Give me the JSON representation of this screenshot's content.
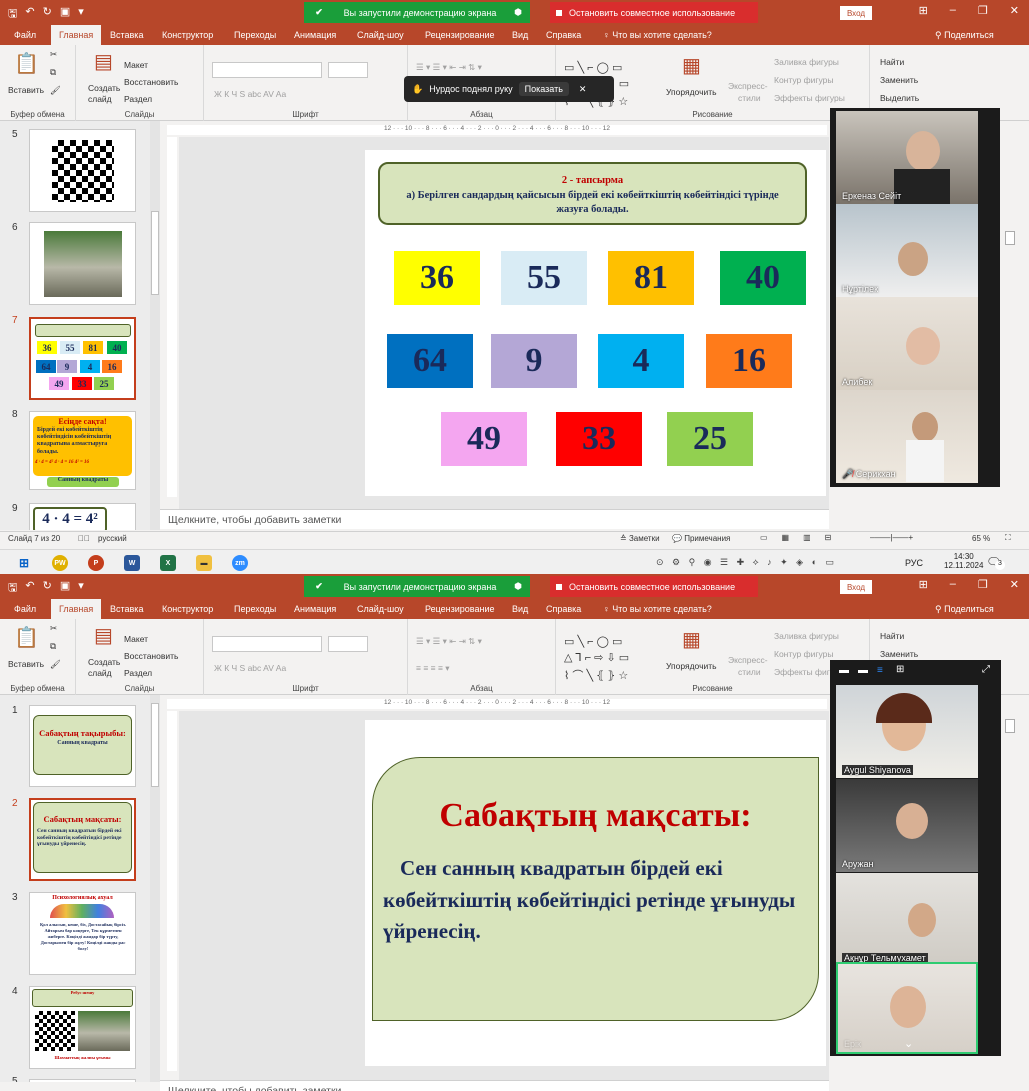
{
  "window": {
    "share_text": "Вы запустили демонстрацию экрана",
    "stop_share": "Остановить совместное использование",
    "sign_in": "Вход"
  },
  "menu": [
    "Файл",
    "Главная",
    "Вставка",
    "Конструктор",
    "Переходы",
    "Анимация",
    "Слайд-шоу",
    "Рецензирование",
    "Вид",
    "Справка"
  ],
  "menu_search": "Что вы хотите сделать?",
  "menu_share": "Поделиться",
  "ribbon": {
    "paste": "Вставить",
    "create": "Создать",
    "slide": "слайд",
    "layout": "Макет",
    "reset": "Восстановить",
    "section": "Раздел",
    "clipboard": "Буфер обмена",
    "slides": "Слайды",
    "font": "Шрифт",
    "paragraph": "Абзац",
    "drawing": "Рисование",
    "arrange": "Упорядочить",
    "express": "Экспресс-",
    "styles": "стили",
    "fill": "Заливка фигуры",
    "outline": "Контур фигуры",
    "effects": "Эффекты фигуры",
    "find": "Найти",
    "replace": "Заменить",
    "select": "Выделить",
    "fmt_buttons": "Ж  К  Ч  S  abc  AV  Aa"
  },
  "notify": {
    "text": "Нурдос поднял руку",
    "show": "Показать"
  },
  "ruler_text": "12 · · · 10 · · · 8 · · · 6 · · · 4 · · · 2 · · · 0 · · · 2 · · · 4 · · · 6 · · · 8 · · · 10 · · · 12",
  "top": {
    "thumb_nums": [
      "5",
      "6",
      "7",
      "8",
      "9"
    ],
    "slide8": {
      "title": "Есіңде сақта!",
      "body": "Бірдей екі көбейткіштің көбейтіндісін көбейткіштің квадратына алмастыруға болады.",
      "formula": "4 · 4 = 4²   4 · 4 = 16   4² = 16",
      "footer": "Санның квадраты"
    },
    "slide9_formula": "4 · 4 = 4²",
    "slide": {
      "task_title": "2 - тапсырма",
      "task_body": "а) Берілген сандардың қайсысын бірдей екі көбейткіштің көбейтіндісі түрінде жазуға болады.",
      "numbers": [
        {
          "v": "36",
          "c": "#ffff00"
        },
        {
          "v": "55",
          "c": "#d9ecf5"
        },
        {
          "v": "81",
          "c": "#ffc000"
        },
        {
          "v": "40",
          "c": "#00b050"
        },
        {
          "v": "64",
          "c": "#0070c0"
        },
        {
          "v": "9",
          "c": "#b4a7d6"
        },
        {
          "v": "4",
          "c": "#00b0f0"
        },
        {
          "v": "16",
          "c": "#ff7b1a"
        },
        {
          "v": "49",
          "c": "#f4a6f0"
        },
        {
          "v": "33",
          "c": "#ff0000"
        },
        {
          "v": "25",
          "c": "#92d050"
        }
      ]
    },
    "notes": "Щелкните, чтобы добавить заметки",
    "status": {
      "slide": "Слайд 7 из 20",
      "lang": "русский",
      "notes": "Заметки",
      "comments": "Примечания",
      "zoom": "65 %"
    },
    "participants": [
      "Еркеназ Сейіт",
      "Нұртілек",
      "Алибек",
      "Серикхан"
    ]
  },
  "taskbar": {
    "lang": "РУС",
    "time": "14:30",
    "date": "12.11.2024",
    "badge": "3"
  },
  "bottom": {
    "thumb_nums": [
      "1",
      "2",
      "3",
      "4",
      "5"
    ],
    "slide1": {
      "title": "Сабақтың тақырыбы:",
      "sub": "Санның квадраты"
    },
    "slide2": {
      "title": "Сабақтың мақсаты:",
      "body": "Сен санның квадратын бірдей екі көбейткіштің көбейтіндісі ретінде ұғынуды үйренесің."
    },
    "slide3": {
      "title": "Психологиялық ахуал",
      "body": "Қол алысып, кеше, біз, Достасайық бірсіз. Айтарым бар коцерге, Тек құрметпен жиберге. Көңілді жандар бір түрту, Достарымен бір жұту! Көңілді жанды рас болу!"
    },
    "slide4": {
      "title": "Ребус шешу",
      "footer": "Шахматтың жалпы ұғымы"
    },
    "slide": {
      "title": "Сабақтың мақсаты:",
      "body": "Сен санның квадратын бірдей екі көбейткіштің көбейтіндісі ретінде ұғынуды үйренесің."
    },
    "notes": "Щелкните, чтобы добавить заметки",
    "participants": [
      "Aygul Shiyanova",
      "Аружан",
      "Ақнұр Тельмухамет",
      "Ерік"
    ]
  }
}
